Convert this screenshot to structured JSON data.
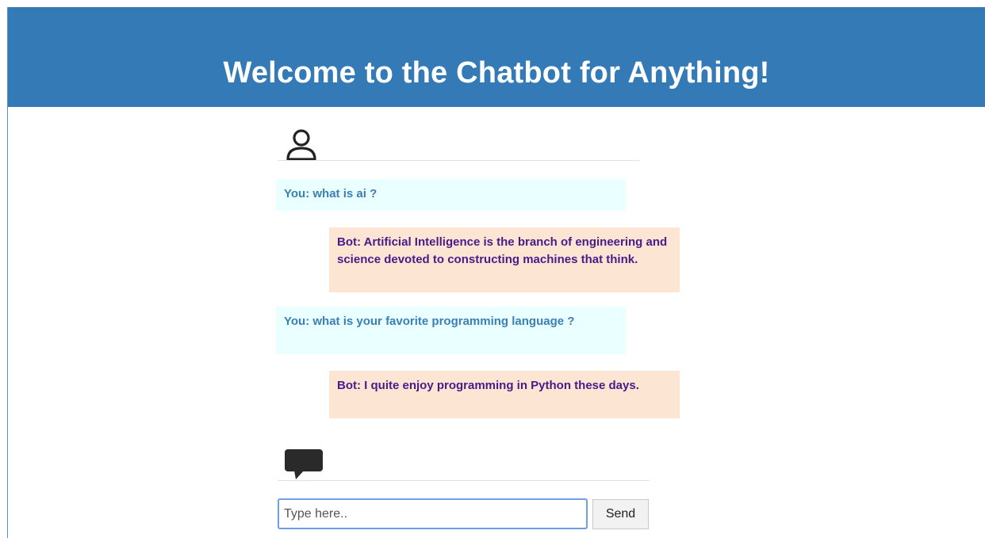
{
  "header": {
    "title": "Welcome to the Chatbot for Anything!"
  },
  "chat": {
    "header_icon": "user-icon",
    "messages": [
      {
        "sender": "user",
        "text": "You: what is ai ?"
      },
      {
        "sender": "bot",
        "text": "Bot: Artificial Intelligence is the branch of engineering and science devoted to constructing machines that think."
      },
      {
        "sender": "user",
        "text": "You: what is your favorite programming language ?"
      },
      {
        "sender": "bot",
        "text": "Bot: I quite enjoy programming in Python these days."
      }
    ]
  },
  "composer": {
    "icon": "chat-bubble-icon",
    "input_value": "",
    "placeholder": "Type here..",
    "send_label": "Send"
  },
  "colors": {
    "header_bg": "#337ab7",
    "user_bubble_bg": "#eaffff",
    "user_text": "#3a7fb5",
    "bot_bubble_bg": "#fce5d2",
    "bot_text": "#4a1a8a"
  }
}
